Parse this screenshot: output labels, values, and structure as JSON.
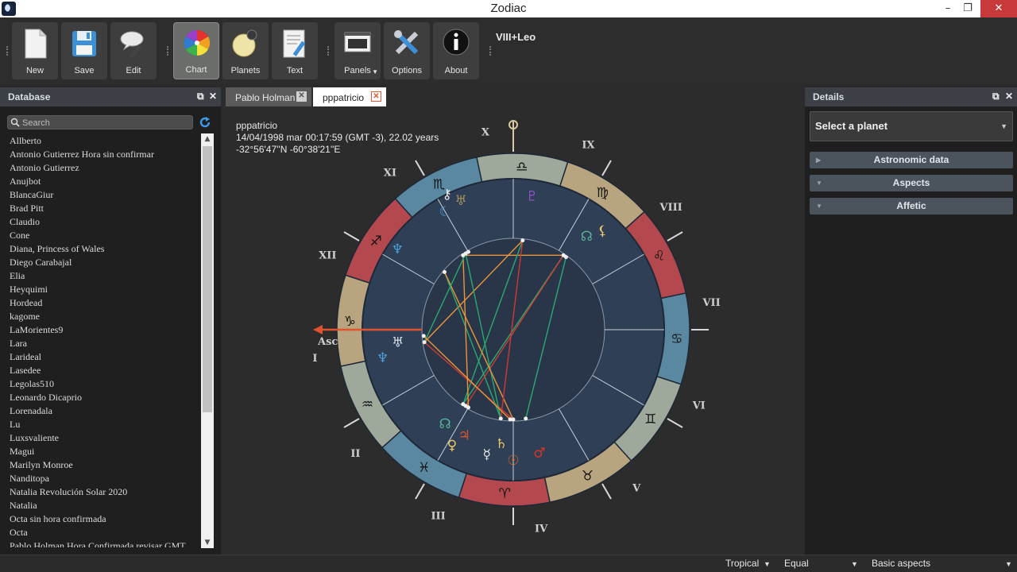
{
  "window": {
    "title": "Zodiac",
    "minimize": "–",
    "maximize": "❐",
    "close": "✕"
  },
  "toolbar": {
    "buttons": [
      {
        "label": "New"
      },
      {
        "label": "Save"
      },
      {
        "label": "Edit"
      },
      {
        "label": "Chart"
      },
      {
        "label": "Planets"
      },
      {
        "label": "Text"
      },
      {
        "label": "Panels"
      },
      {
        "label": "Options"
      },
      {
        "label": "About"
      }
    ],
    "chart_label": "VIII+Leo"
  },
  "database": {
    "title": "Database",
    "search_placeholder": "Search",
    "items": [
      "Allberto",
      "Antonio Gutierrez Hora sin confirmar",
      "Antonio Gutierrez",
      "Anujbot",
      "BlancaGiur",
      "Brad Pitt",
      "Claudio",
      "Cone",
      "Diana, Princess of Wales",
      "Diego Carabajal",
      "Elia",
      "Heyquimi",
      "Hordead",
      "kagome",
      "LaMorientes9",
      "Lara",
      "Larideal",
      "Lasedee",
      "Legolas510",
      "Leonardo Dicaprio",
      "Lorenadala",
      "Lu",
      "Luxsvaliente",
      "Magui",
      "Marilyn Monroe",
      "Nanditopa",
      "Natalia Revolución Solar 2020",
      "Natalia",
      "Octa sin hora confirmada",
      "Octa",
      "Pablo Holman Hora Confirmada revisar GMT"
    ]
  },
  "tabs": [
    {
      "label": "Pablo Holman",
      "active": false
    },
    {
      "label": "pppatricio",
      "active": true
    }
  ],
  "chart": {
    "name": "pppatricio",
    "datetime": "14/04/1998 mar 00:17:59 (GMT -3), 22.02 years",
    "coords": "-32°56'47''N  -60°38'21''E",
    "asc_label": "Asc",
    "houses": [
      "I",
      "II",
      "III",
      "IV",
      "V",
      "VI",
      "VII",
      "VIII",
      "IX",
      "X",
      "XI",
      "XII"
    ],
    "sign_glyphs": [
      "♈",
      "♉",
      "♊",
      "♋",
      "♌",
      "♍",
      "♎",
      "♏",
      "♐",
      "♑",
      "♒",
      "♓"
    ],
    "sign_colors": [
      "#b3494e",
      "#b8a57f",
      "#9ea99b",
      "#5a88a0"
    ],
    "planets": [
      {
        "glyph": "♃",
        "color": "#e0532f"
      },
      {
        "glyph": "♀",
        "color": "#e9c66a"
      },
      {
        "glyph": "☊",
        "color": "#59b59a"
      },
      {
        "glyph": "♆",
        "color": "#4d9fd6"
      },
      {
        "glyph": "♅",
        "color": "#d8dde8"
      },
      {
        "glyph": "☾",
        "color": "#4d9fd6"
      },
      {
        "glyph": "⚷",
        "color": "#e9e9e9"
      },
      {
        "glyph": "♅",
        "color": "#a09060"
      },
      {
        "glyph": "♆",
        "color": "#4d9fd6"
      },
      {
        "glyph": "♇",
        "color": "#8b54c8"
      },
      {
        "glyph": "☊",
        "color": "#59b59a"
      },
      {
        "glyph": "⚸",
        "color": "#e9c66a"
      },
      {
        "glyph": "☿",
        "color": "#e9e9e9"
      },
      {
        "glyph": "☉",
        "color": "#e86b20"
      },
      {
        "glyph": "♂",
        "color": "#d9332b"
      },
      {
        "glyph": "♄",
        "color": "#e9c66a"
      }
    ],
    "aspect_colors": {
      "trine": "#2aa970",
      "square": "#d03a32",
      "sextile": "#e9963a"
    }
  },
  "details": {
    "title": "Details",
    "select_label": "Select a planet",
    "sections": [
      "Astronomic data",
      "Aspects",
      "Affetic"
    ]
  },
  "statusbar": {
    "zodiac": "Tropical",
    "houses": "Equal",
    "aspects": "Basic aspects"
  }
}
